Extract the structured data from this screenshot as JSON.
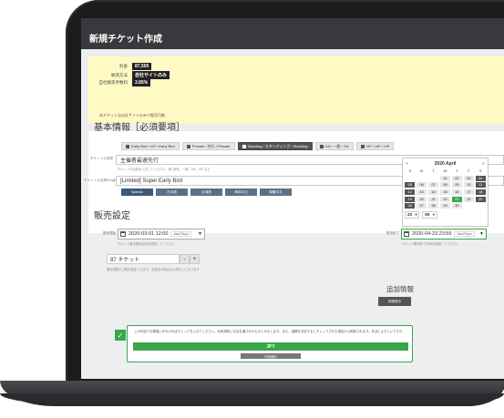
{
  "window": {
    "title": "新規チケット作成"
  },
  "summary": {
    "rows": [
      {
        "label": "料金",
        "value": "87,500"
      },
      {
        "label": "販売方法",
        "value": "自社サイトのみ"
      },
      {
        "label": "自社販売手数料",
        "value": "3.85%"
      }
    ],
    "note": "本チケットは自社サイトのみで販売可能"
  },
  "basic": {
    "heading": "基本情報［必須要項］",
    "tabs": [
      "Early Bird / VIP / Early Bird",
      "Presale / 先行 / Presale",
      "Standing / スタンディング / Standing",
      "GA / 一般 / GA",
      "VIP / VIP / VIP"
    ],
    "active_tab": 2,
    "ticket_name_label": "チケットの名称",
    "ticket_name_value": "主催者最速先行",
    "ticket_name_hint": "チケットの名前を入力してください。例: 前売、一般、GA、VIP など",
    "english_label": "チケットの名称(English)",
    "english_value": "[Limited] Super Early Bird",
    "languages": [
      "Spanish",
      "日本語",
      "台湾語",
      "简体中文",
      "繁體中文"
    ]
  },
  "sales": {
    "heading": "販売設定",
    "start_label": "販売開始",
    "start_value": "2020-03-01 12:00",
    "start_tz": "Asia/Tokyo",
    "start_hint": "チケット販売開始日時を選択してください",
    "end_label": "販売終了",
    "end_value": "2020-04-23 23:59",
    "end_tz": "Asia/Tokyo",
    "end_hint": "チケット販売終了日時を選択してください",
    "quantity_value": "87 チケット",
    "quantity_minus": "-",
    "quantity_plus": "+",
    "quantity_hint": "販売枚数の上限を設定できます。未設定の場合は上限なしになります",
    "calendar": {
      "prev": "‹",
      "next": "›",
      "month": "2020 April",
      "weekdays": [
        "S",
        "M",
        "T",
        "W",
        "T",
        "F",
        "S"
      ],
      "selected_day": "23",
      "hour": "23",
      "minute": "59"
    }
  },
  "extra": {
    "heading": "追加情報",
    "detail_button": "詳細表示"
  },
  "confirm": {
    "agreement": "上の内容でお間違いがなければチェックを入れてください。利用規約にお目を通されたものとみなします。また、価格を決定するとチェックされた項目から削除されます。本当によろしいですか。",
    "jpy_button": "JPY",
    "sub_button": "利用規約",
    "checkmark": "✓"
  },
  "colors": {
    "accent": "#3aa54a",
    "titlebar": "#38393c",
    "summary_bg": "#fff9c4"
  }
}
